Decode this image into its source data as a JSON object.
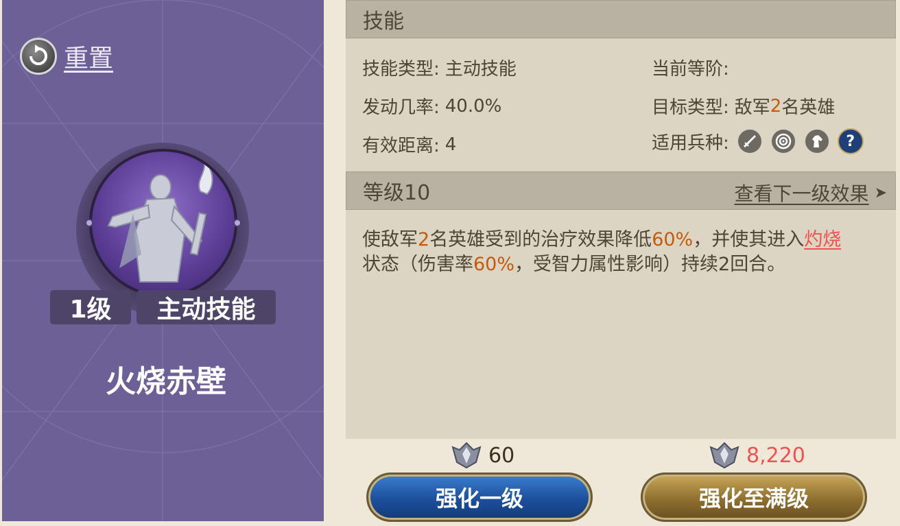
{
  "left": {
    "reset_label": "重置",
    "level_tag": "1级",
    "type_tag": "主动技能",
    "skill_name": "火烧赤壁"
  },
  "skill_section": {
    "title": "技能",
    "rows": {
      "skill_type_label": "技能类型:",
      "skill_type_value": "主动技能",
      "current_rank_label": "当前等阶:",
      "current_rank_value": "",
      "trigger_rate_label": "发动几率:",
      "trigger_rate_value": "40.0%",
      "target_type_label": "目标类型:",
      "target_type_prefix": "敌军",
      "target_type_count": "2",
      "target_type_suffix": "名英雄",
      "range_label": "有效距离:",
      "range_value": "4",
      "troop_type_label": "适用兵种:"
    },
    "troop_icons": [
      "sword-icon",
      "target-icon",
      "horse-icon",
      "question-icon"
    ]
  },
  "level_section": {
    "title": "等级10",
    "next_link": "查看下一级效果",
    "next_arrow": "➤",
    "desc": {
      "p1": "使敌军",
      "n1": "2",
      "p2": "名英雄受到的治疗效果降低",
      "n2": "60%",
      "p3": "，并使其进入",
      "burn": "灼烧",
      "p4": "状态（伤害率",
      "n3": "60%",
      "p5": "，受智力属性影响）持续2回合。"
    }
  },
  "costs": {
    "single": "60",
    "max": "8,220"
  },
  "buttons": {
    "upgrade_one": "强化一级",
    "upgrade_max": "强化至满级"
  },
  "colors": {
    "panel_purple": "#6d6097",
    "highlight_orange": "#c45a0b",
    "warning_red": "#f05050",
    "button_blue": "#1d4f9c",
    "button_gold": "#8f6f2f"
  }
}
